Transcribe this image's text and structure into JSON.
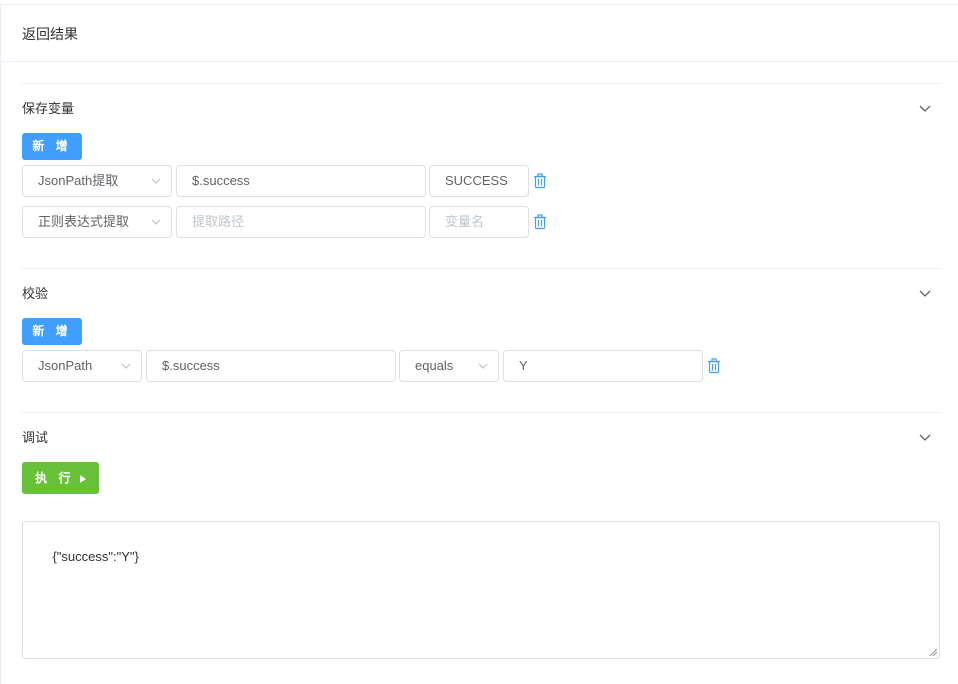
{
  "card": {
    "title": "返回结果"
  },
  "sections": {
    "save_vars": {
      "title": "保存变量",
      "add_label": "新 增"
    },
    "validate": {
      "title": "校验",
      "add_label": "新 增"
    },
    "debug": {
      "title": "调试",
      "run_label": "执 行"
    }
  },
  "save_rows": [
    {
      "extract_type": "JsonPath提取",
      "path_value": "$.success",
      "path_placeholder": "提取路径",
      "var_value": "SUCCESS",
      "var_placeholder": "变量名"
    },
    {
      "extract_type": "正则表达式提取",
      "path_value": "",
      "path_placeholder": "提取路径",
      "var_value": "",
      "var_placeholder": "变量名"
    }
  ],
  "validate_rows": [
    {
      "type": "JsonPath",
      "path": "$.success",
      "operator": "equals",
      "expected": "Y"
    }
  ],
  "debug_output": "{\"success\":\"Y\"}",
  "colors": {
    "primary": "#409eff",
    "success": "#67c23a",
    "border": "#dcdfe6",
    "divider": "#ebeef5"
  },
  "icons": {
    "collapse": "chevron-down-icon",
    "delete": "trash-icon",
    "run": "play-icon",
    "dropdown": "caret-down-icon"
  }
}
